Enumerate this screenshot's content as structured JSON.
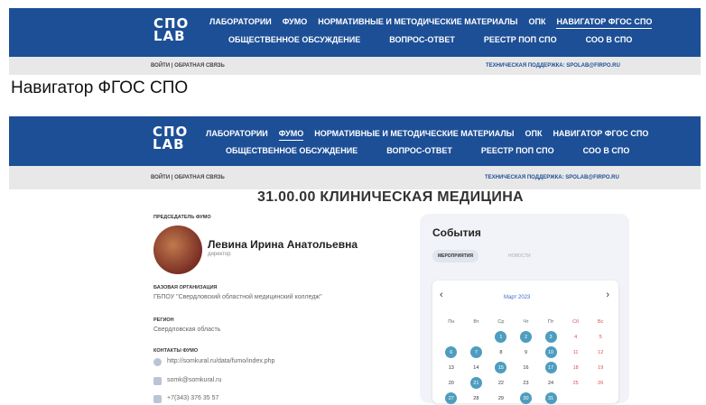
{
  "logo": {
    "line1": "СПО",
    "line2": "LAB"
  },
  "nav": {
    "row1": [
      "ЛАБОРАТОРИИ",
      "ФУМО",
      "НОРМАТИВНЫЕ И МЕТОДИЧЕСКИЕ МАТЕРИАЛЫ",
      "ОПК",
      "НАВИГАТОР ФГОС СПО"
    ],
    "row2": [
      "ОБЩЕСТВЕННОЕ ОБСУЖДЕНИЕ",
      "ВОПРОС-ОТВЕТ",
      "РЕЕСТР ПОП СПО",
      "СОО В СПО"
    ]
  },
  "topbar": {
    "login": "ВОЙТИ | ОБРАТНАЯ СВЯЗЬ",
    "support": "ТЕХНИЧЕСКАЯ ПОДДЕРЖКА: SPOLAB@FIRPO.RU"
  },
  "page_title": "Навигатор ФГОС СПО",
  "main_title": "31.00.00 КЛИНИЧЕСКАЯ МЕДИЦИНА",
  "chair": {
    "label": "ПРЕДСЕДАТЕЛЬ ФУМО",
    "name": "Левина Ирина Анатольевна",
    "position": "директор"
  },
  "org": {
    "label": "БАЗОВАЯ ОРГАНИЗАЦИЯ",
    "value": "ГБПОУ \"Свердловский областной медицинский колледж\""
  },
  "region": {
    "label": "РЕГИОН",
    "value": "Свердловская область"
  },
  "contacts": {
    "label": "КОНТАКТЫ ФУМО",
    "site": "http://somkural.ru/data/fumo/index.php",
    "email": "somk@somkural.ru",
    "phone": "+7(343) 376 35 57"
  },
  "events": {
    "title": "События",
    "tab_events": "МЕРОПРИЯТИЯ",
    "tab_news": "НОВОСТИ",
    "calendar": {
      "prev": "‹",
      "next": "›",
      "month": "Март 2023",
      "weekdays": [
        "Пн",
        "Вт",
        "Ср",
        "Чт",
        "Пт",
        "Сб",
        "Вс"
      ],
      "rows": [
        [
          "",
          "",
          "1",
          "2",
          "3",
          "4",
          "5"
        ],
        [
          "6",
          "7",
          "8",
          "9",
          "10",
          "11",
          "12"
        ],
        [
          "13",
          "14",
          "15",
          "16",
          "17",
          "18",
          "19"
        ],
        [
          "20",
          "21",
          "22",
          "23",
          "24",
          "25",
          "26"
        ],
        [
          "27",
          "28",
          "29",
          "30",
          "31",
          "",
          ""
        ]
      ],
      "event_days": [
        "1",
        "2",
        "3",
        "6",
        "7",
        "10",
        "15",
        "17",
        "21",
        "27",
        "30",
        "31"
      ]
    }
  }
}
